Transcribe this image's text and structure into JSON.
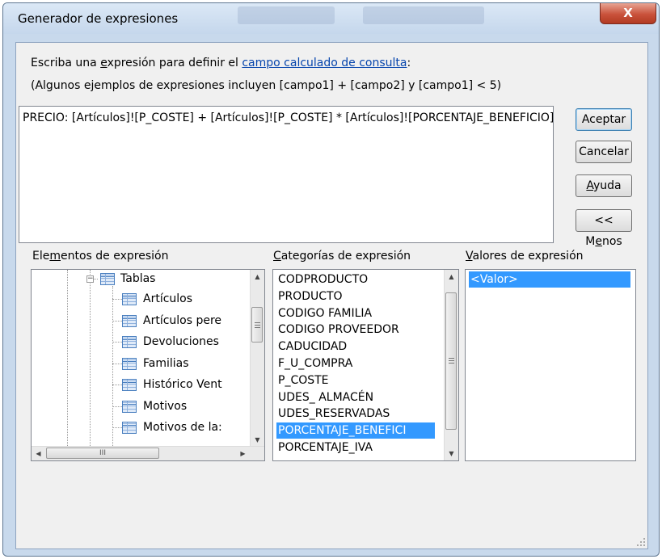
{
  "window": {
    "title": "Generador de expresiones",
    "close_label": "X"
  },
  "prompt": {
    "prefix_1": "Escriba una ",
    "prefix_underlined": "e",
    "prefix_2": "xpresión para definir el ",
    "link": "campo calculado de consulta",
    "suffix": ":",
    "examples": "(Algunos ejemplos de expresiones incluyen [campo1] + [campo2] y [campo1] < 5)"
  },
  "expression": {
    "value": "PRECIO: [Artículos]![P_COSTE] + [Artículos]![P_COSTE] * [Artículos]![PORCENTAJE_BENEFICIO]"
  },
  "buttons": {
    "accept": "Aceptar",
    "cancel": "Cancelar",
    "help_underlined": "A",
    "help_rest": "yuda",
    "less_prefix": "<< M",
    "less_underlined": "e",
    "less_rest": "nos"
  },
  "elements_panel": {
    "label_1": "Ele",
    "label_underlined": "m",
    "label_2": "entos de expresión",
    "root": {
      "label": "Tablas",
      "expander": "−"
    },
    "items": [
      {
        "label": "Artículos",
        "selected": false
      },
      {
        "label": "Artículos pere",
        "selected": false
      },
      {
        "label": "Devoluciones",
        "selected": false
      },
      {
        "label": "Familias",
        "selected": false
      },
      {
        "label": "Histórico Vent",
        "selected": false
      },
      {
        "label": "Motivos",
        "selected": false
      },
      {
        "label": "Motivos de la:",
        "selected": false
      }
    ]
  },
  "categories_panel": {
    "label_underlined": "C",
    "label_rest": "ategorías de expresión",
    "items": [
      {
        "label": "CODPRODUCTO",
        "selected": false
      },
      {
        "label": "PRODUCTO",
        "selected": false
      },
      {
        "label": "CODIGO FAMILIA",
        "selected": false
      },
      {
        "label": "CODIGO PROVEEDOR",
        "selected": false
      },
      {
        "label": "CADUCIDAD",
        "selected": false
      },
      {
        "label": "F_U_COMPRA",
        "selected": false
      },
      {
        "label": "P_COSTE",
        "selected": false
      },
      {
        "label": "UDES_ ALMACÉN",
        "selected": false
      },
      {
        "label": "UDES_RESERVADAS",
        "selected": false
      },
      {
        "label": "PORCENTAJE_BENEFICI",
        "selected": true
      },
      {
        "label": "PORCENTAJE_IVA",
        "selected": false
      }
    ]
  },
  "values_panel": {
    "label_underlined": "V",
    "label_rest": "alores de expresión",
    "items": [
      {
        "label": "<Valor>",
        "selected": true
      }
    ]
  },
  "scroll": {
    "up_arrow": "▲",
    "down_arrow": "▼",
    "left_arrow": "◀",
    "right_arrow": "▶",
    "h_thumb_grip": "III",
    "elements_h_position": 0.0
  },
  "colors": {
    "selection": "#3399ff",
    "link": "#0645ad",
    "close_button": "#c9523b"
  }
}
